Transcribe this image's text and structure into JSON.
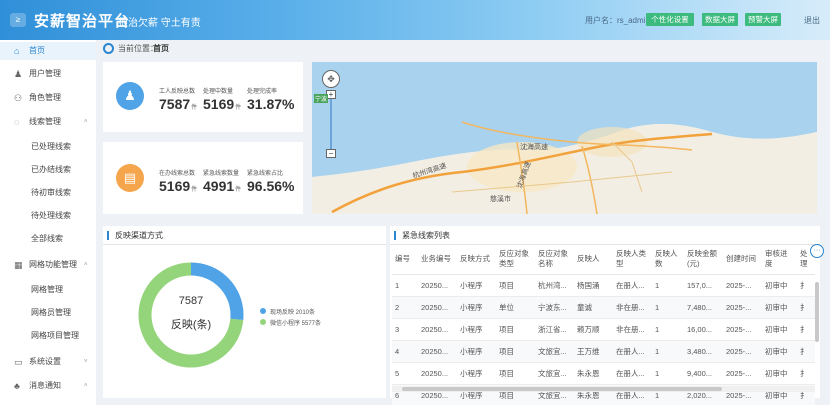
{
  "header": {
    "logo_glyph": "≥",
    "brand": "安薪智治平台",
    "slogan": "根治欠薪 守土有责",
    "user_label": "用户名：rs_admin",
    "buttons": [
      "个性化设置",
      "数据大屏",
      "预警大屏"
    ],
    "logout": "退出"
  },
  "sidebar": {
    "items": [
      {
        "icon": "home-icon",
        "glyph": "⌂",
        "label": "首页",
        "active": true
      },
      {
        "icon": "user-icon",
        "glyph": "♟",
        "label": "用户管理"
      },
      {
        "icon": "role-icon",
        "glyph": "⚇",
        "label": "角色管理"
      },
      {
        "icon": "shield-icon",
        "glyph": "◌",
        "label": "线索管理",
        "arrow": "˄"
      }
    ],
    "sub_clues": [
      "已处理线索",
      "已办结线索",
      "待初审线索",
      "待处理线索",
      "全部线索"
    ],
    "grid": {
      "icon": "grid-icon",
      "glyph": "▦",
      "label": "网格功能管理",
      "arrow": "˄"
    },
    "sub_grid": [
      "网格管理",
      "网格员管理",
      "网格项目管理"
    ],
    "bottom": [
      {
        "icon": "monitor-icon",
        "glyph": "▭",
        "label": "系统设置",
        "arrow": "˅"
      },
      {
        "icon": "bell-icon",
        "glyph": "♣",
        "label": "消息通知",
        "arrow": "˄"
      }
    ]
  },
  "breadcrumb": {
    "prefix": "当前位置：",
    "current": "首页"
  },
  "stats": {
    "row1": [
      {
        "label": "工人反映总数",
        "value": "7587",
        "unit": "件"
      },
      {
        "label": "处理中数量",
        "value": "5169",
        "unit": "件"
      },
      {
        "label": "处理完成率",
        "value": "31.87%",
        "unit": ""
      }
    ],
    "row2": [
      {
        "label": "在办线索总数",
        "value": "5169",
        "unit": "件"
      },
      {
        "label": "紧急线索数量",
        "value": "4991",
        "unit": "件"
      },
      {
        "label": "紧急线索占比",
        "value": "96.56%",
        "unit": ""
      }
    ],
    "colors": {
      "blue": "#4fa3e6",
      "orange": "#f5a64c"
    }
  },
  "map": {
    "labels": [
      "杭州湾高速",
      "沈海高速",
      "沈海高速",
      "慈溪市"
    ],
    "badge": "宁波"
  },
  "channel_panel": {
    "title": "反映渠道方式",
    "center_value": "7587",
    "center_label": "反映(条)",
    "legend": [
      {
        "label": "现场反映  2010条",
        "value": 2010,
        "color": "#4fa3e6"
      },
      {
        "label": "微信小程序  5577条",
        "value": 5577,
        "color": "#94d47a"
      }
    ]
  },
  "urgent_panel": {
    "title": "紧急线索列表",
    "headers": [
      "编号",
      "业务编号",
      "反映方式",
      "反应对象类型",
      "反应对象名称",
      "反映人",
      "反映人类型",
      "反映人数",
      "反映金额(元)",
      "创建时间",
      "审核进度",
      "处理"
    ],
    "rows": [
      [
        "1",
        "20250...",
        "小程序",
        "项目",
        "杭州湾...",
        "杨国涌",
        "在册人...",
        "1",
        "157,0...",
        "2025-...",
        "初审中",
        "扌"
      ],
      [
        "2",
        "20250...",
        "小程序",
        "单位",
        "宁波东...",
        "童诚",
        "非在册...",
        "1",
        "7,480...",
        "2025-...",
        "初审中",
        "扌"
      ],
      [
        "3",
        "20250...",
        "小程序",
        "项目",
        "浙江省...",
        "赖万顺",
        "非在册...",
        "1",
        "16,00...",
        "2025-...",
        "初审中",
        "扌"
      ],
      [
        "4",
        "20250...",
        "小程序",
        "项目",
        "文旅宜...",
        "王万维",
        "在册人...",
        "1",
        "3,480...",
        "2025-...",
        "初审中",
        "扌"
      ],
      [
        "5",
        "20250...",
        "小程序",
        "项目",
        "文旅宜...",
        "朱永恩",
        "在册人...",
        "1",
        "9,400...",
        "2025-...",
        "初审中",
        "扌"
      ],
      [
        "6",
        "20250...",
        "小程序",
        "项目",
        "文旅宜...",
        "朱永恩",
        "在册人...",
        "1",
        "2,020...",
        "2025-...",
        "初审中",
        "扌"
      ]
    ]
  }
}
